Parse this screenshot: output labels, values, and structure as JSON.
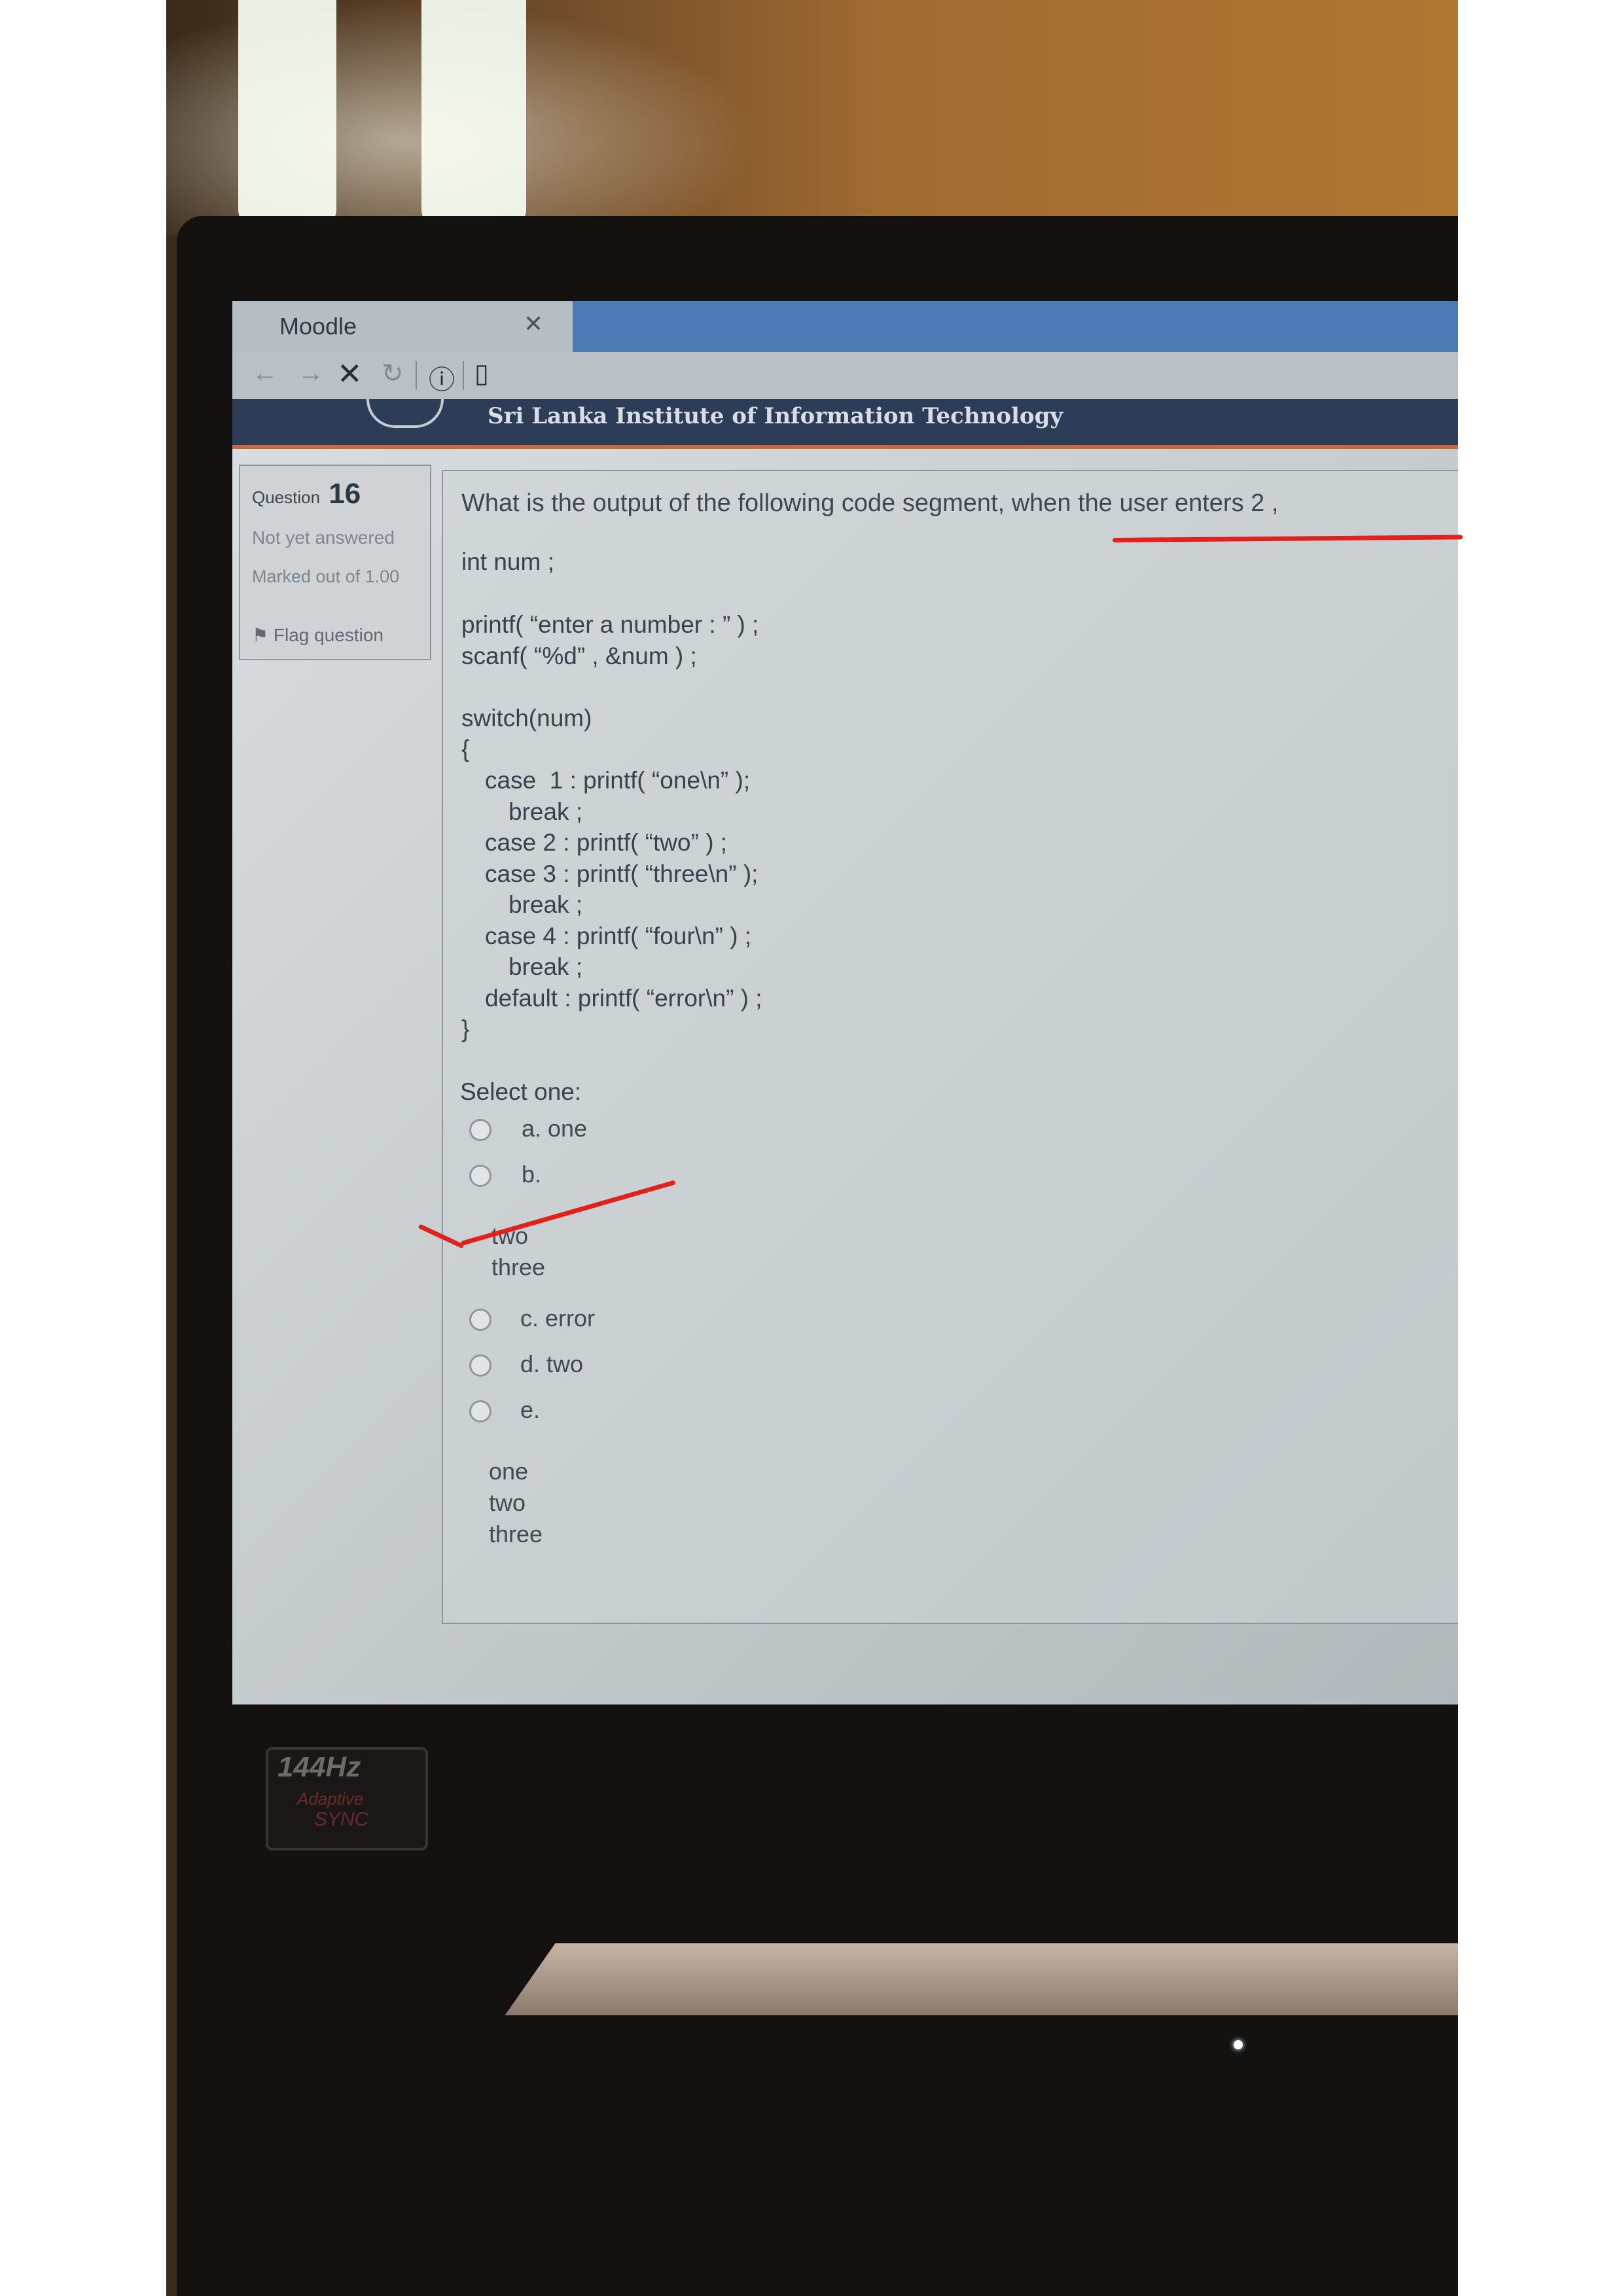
{
  "browser": {
    "tab_title": "Moodle",
    "tab_close_icon": "close-icon",
    "nav_icons": [
      "back-arrow-icon",
      "forward-arrow-icon",
      "stop-icon",
      "reload-icon",
      "info-icon",
      "page-icon"
    ]
  },
  "site": {
    "institution": "Sri Lanka Institute of Information Technology"
  },
  "question_info": {
    "question_label": "Question",
    "number": "16",
    "status": "Not yet answered",
    "marked": "Marked out of 1.00",
    "flag_label": "Flag question"
  },
  "question": {
    "text": "What is the output of the following code segment, when the user enters 2 ,",
    "code": [
      "int num ;",
      "printf( “enter a number : ” ) ;",
      "scanf( “%d” , &num ) ;",
      "switch(num)",
      "{",
      "case  1 : printf( “one\\n” );",
      "break ;",
      "case 2 : printf( “two” ) ;",
      "case 3 : printf( “three\\n” );",
      "break ;",
      "case 4 : printf( “four\\n” ) ;",
      "break ;",
      "default : printf( “error\\n” ) ;",
      "}"
    ],
    "select_label": "Select one:",
    "options": [
      {
        "label": "a. one",
        "extra": []
      },
      {
        "label": "b.",
        "extra": [
          "two",
          "three"
        ]
      },
      {
        "label": "c. error",
        "extra": []
      },
      {
        "label": "d. two",
        "extra": []
      },
      {
        "label": "e.",
        "extra": [
          "one",
          "two",
          "three"
        ]
      }
    ]
  },
  "laptop": {
    "sticker_line1": "144Hz",
    "sticker_line2": "Adaptive",
    "sticker_line3": "SYNC"
  },
  "colors": {
    "ink_red": "#e1221c",
    "header_navy": "#2d3d57",
    "tab_blue": "#4d79b4"
  }
}
